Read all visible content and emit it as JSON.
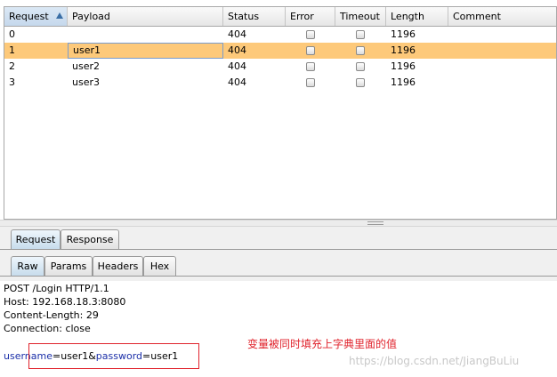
{
  "table": {
    "columns": [
      {
        "key": "request",
        "label": "Request",
        "sorted": true
      },
      {
        "key": "payload",
        "label": "Payload"
      },
      {
        "key": "status",
        "label": "Status"
      },
      {
        "key": "error",
        "label": "Error"
      },
      {
        "key": "timeout",
        "label": "Timeout"
      },
      {
        "key": "length",
        "label": "Length"
      },
      {
        "key": "comment",
        "label": "Comment"
      }
    ],
    "rows": [
      {
        "request": "0",
        "payload": "",
        "status": "404",
        "error": false,
        "timeout": false,
        "length": "1196",
        "comment": "",
        "selected": false
      },
      {
        "request": "1",
        "payload": "user1",
        "status": "404",
        "error": false,
        "timeout": false,
        "length": "1196",
        "comment": "",
        "selected": true
      },
      {
        "request": "2",
        "payload": "user2",
        "status": "404",
        "error": false,
        "timeout": false,
        "length": "1196",
        "comment": "",
        "selected": false
      },
      {
        "request": "3",
        "payload": "user3",
        "status": "404",
        "error": false,
        "timeout": false,
        "length": "1196",
        "comment": "",
        "selected": false
      }
    ]
  },
  "tabs_top": [
    {
      "label": "Request",
      "active": true
    },
    {
      "label": "Response",
      "active": false
    }
  ],
  "tabs_sub": [
    {
      "label": "Raw",
      "active": true
    },
    {
      "label": "Params",
      "active": false
    },
    {
      "label": "Headers",
      "active": false
    },
    {
      "label": "Hex",
      "active": false
    }
  ],
  "request_lines": [
    "POST /Login HTTP/1.1",
    "Host: 192.168.18.3:8080",
    "Content-Length: 29",
    "Connection: close"
  ],
  "body_params": {
    "k1": "username",
    "eq1": "=",
    "v1": "user1",
    "amp": "&",
    "k2": "password",
    "eq2": "=",
    "v2": "user1"
  },
  "annotation": "变量被同时填充上字典里面的值",
  "watermark": "https://blog.csdn.net/JiangBuLiu",
  "colors": {
    "selected_row": "#fdc97a",
    "annotation": "#e0232c",
    "param_key": "#1b2fa8"
  }
}
